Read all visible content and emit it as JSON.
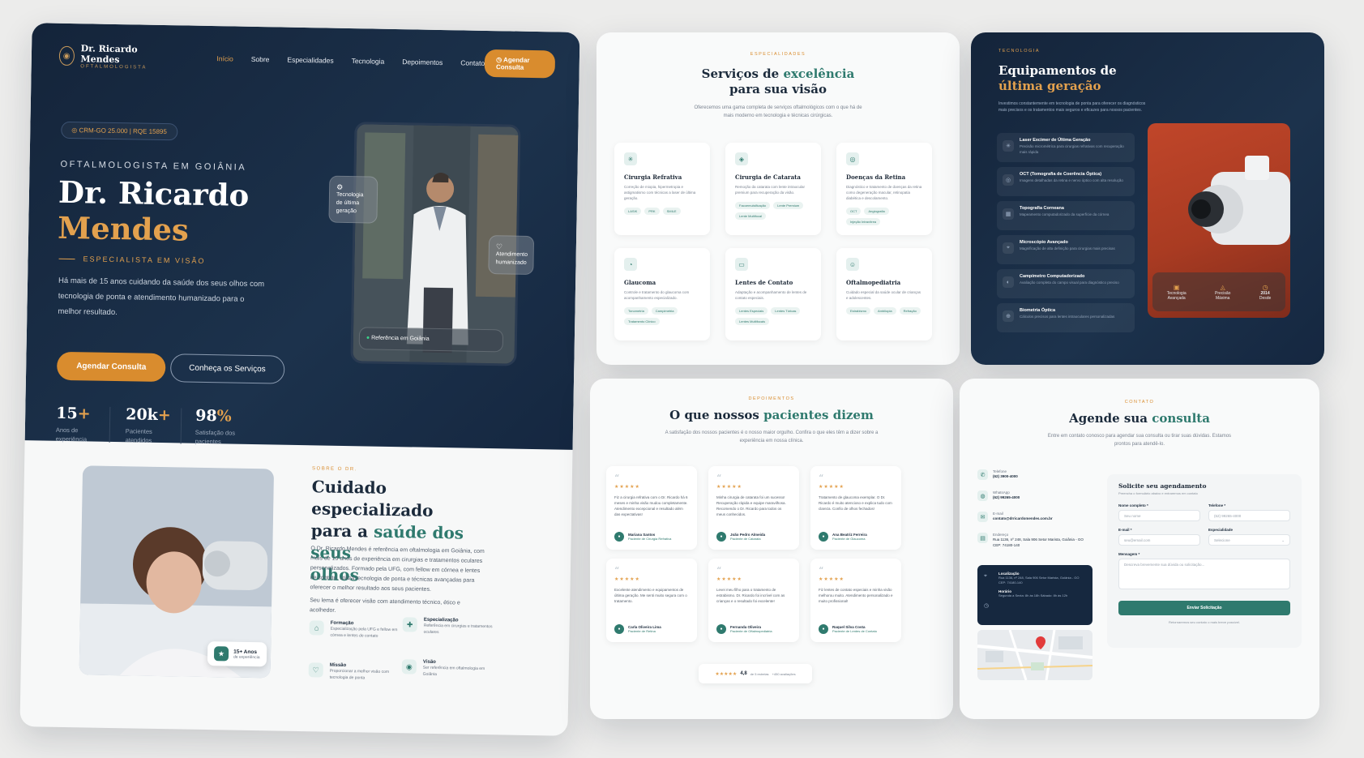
{
  "hero": {
    "logo_name": "Dr. Ricardo Mendes",
    "logo_sub": "OFTALMOLOGISTA",
    "nav": [
      "Início",
      "Sobre",
      "Especialidades",
      "Tecnologia",
      "Depoimentos",
      "Contato"
    ],
    "nav_button": "Agendar Consulta",
    "crm": "CRM-GO 25.000 | RQE 15895",
    "kicker": "OFTALMOLOGISTA EM GOIÂNIA",
    "name_line1": "Dr. Ricardo",
    "name_line2": "Mendes",
    "specialty": "ESPECIALISTA EM VISÃO",
    "description": "Há mais de 15 anos cuidando da saúde dos seus olhos com tecnologia de ponta e atendimento humanizado para o melhor resultado.",
    "cta_primary": "Agendar Consulta",
    "cta_secondary": "Conheça os Serviços",
    "stats": [
      {
        "value": "15",
        "suffix": "+",
        "label": "Anos de experiência"
      },
      {
        "value": "20k",
        "suffix": "+",
        "label": "Pacientes atendidos"
      },
      {
        "value": "98",
        "suffix": "%",
        "label": "Satisfação dos pacientes"
      }
    ],
    "badge_tech": "Tecnologia de última geração",
    "badge_care": "Atendimento humanizado",
    "badge_ref": "Referência em Goiânia"
  },
  "about": {
    "kicker": "SOBRE O DR.",
    "title_a": "Cuidado especializado",
    "title_b": "para a ",
    "title_c": "saúde dos seus",
    "title_d": "olhos",
    "p1": "O Dr. Ricardo Mendes é referência em oftalmologia em Goiânia, com mais de 15 anos de experiência em cirurgias e tratamentos oculares personalizados. Formado pela UFG, com fellow em córnea e lentes de contato, utiliza tecnologia de ponta e técnicas avançadas para oferecer o melhor resultado aos seus pacientes.",
    "p2": "Seu lema é oferecer visão com atendimento técnico, ético e acolhedor.",
    "badge_value": "15+ Anos",
    "badge_label": "de experiência",
    "features": [
      {
        "title": "Formação",
        "desc": "Especialização pela UFG e fellow em córnea e lentes de contato"
      },
      {
        "title": "Especialização",
        "desc": "Referência em cirurgias e tratamentos oculares"
      },
      {
        "title": "Missão",
        "desc": "Proporcionar a melhor visão com tecnologia de ponta"
      },
      {
        "title": "Visão",
        "desc": "Ser referência em oftalmologia em Goiânia"
      }
    ]
  },
  "services": {
    "kicker": "ESPECIALIDADES",
    "title_a": "Serviços de ",
    "title_b": "excelência",
    "title_c": " para sua visão",
    "subtitle": "Oferecemos uma gama completa de serviços oftalmológicos com o que há de mais moderno em tecnologia e técnicas cirúrgicas.",
    "items": [
      {
        "title": "Cirurgia Refrativa",
        "desc": "Correção de miopia, hipermetropia e astigmatismo com técnicas a laser de última geração.",
        "tags": [
          "LASIK",
          "PRK",
          "SMILE"
        ]
      },
      {
        "title": "Cirurgia de Catarata",
        "desc": "Remoção da catarata com lente intraocular premium para recuperação da visão.",
        "tags": [
          "Facoemulsificação",
          "Lente Premium",
          "Lente Multifocal"
        ]
      },
      {
        "title": "Doenças da Retina",
        "desc": "Diagnóstico e tratamento de doenças da retina como degeneração macular, retinopatia diabética e descolamento.",
        "tags": [
          "OCT",
          "Angiografia",
          "Injeção Intravítrea"
        ]
      },
      {
        "title": "Glaucoma",
        "desc": "Controle e tratamento do glaucoma com acompanhamento especializado.",
        "tags": [
          "Tonometria",
          "Campimetria",
          "Tratamento Clínico"
        ]
      },
      {
        "title": "Lentes de Contato",
        "desc": "Adaptação e acompanhamento de lentes de contato especiais.",
        "tags": [
          "Lentes Especiais",
          "Lentes Tóricas",
          "Lentes Multifocais"
        ]
      },
      {
        "title": "Oftalmopediatria",
        "desc": "Cuidado especial da saúde ocular de crianças e adolescentes.",
        "tags": [
          "Estrabismo",
          "Ambliopia",
          "Refração"
        ]
      }
    ]
  },
  "technology": {
    "kicker": "TECNOLOGIA",
    "title_a": "Equipamentos de ",
    "title_b": "última geração",
    "subtitle": "Investimos constantemente em tecnologia de ponta para oferecer os diagnósticos mais precisos e os tratamentos mais seguros e eficazes para nossos pacientes.",
    "items": [
      {
        "title": "Laser Excimer de Última Geração",
        "desc": "Precisão micrométrica para cirurgias refrativas com recuperação mais rápida"
      },
      {
        "title": "OCT (Tomografia de Coerência Óptica)",
        "desc": "Imagens detalhadas da retina e nervo óptico com alta resolução"
      },
      {
        "title": "Topografia Corneana",
        "desc": "Mapeamento computadorizado da superfície da córnea"
      },
      {
        "title": "Microscópio Avançado",
        "desc": "Magnificação de alta definição para cirurgias mais precisas"
      },
      {
        "title": "Campímetro Computadorizado",
        "desc": "Avaliação completa do campo visual para diagnóstico preciso"
      },
      {
        "title": "Biometria Óptica",
        "desc": "Cálculos precisos para lentes intraoculares personalizadas"
      }
    ],
    "badges": [
      {
        "value": "Tecnologia",
        "label": "Avançada"
      },
      {
        "value": "Precisão",
        "label": "Máxima"
      },
      {
        "value": "2014",
        "label": "Desde"
      }
    ]
  },
  "testimonials": {
    "kicker": "DEPOIMENTOS",
    "title_a": "O que nossos ",
    "title_b": "pacientes dizem",
    "subtitle": "A satisfação dos nossos pacientes é o nosso maior orgulho. Confira o que eles têm a dizer sobre a experiência em nossa clínica.",
    "items": [
      {
        "stars": "★★★★★",
        "text": "Fiz a cirurgia refrativa com o Dr. Ricardo há 6 meses e minha visão mudou completamente. Atendimento excepcional e resultado além das expectativas!",
        "name": "Mariana Santos",
        "role": "Paciente de Cirurgia Refrativa"
      },
      {
        "stars": "★★★★★",
        "text": "Minha cirurgia de catarata foi um sucesso! Recuperação rápida e equipe maravilhosa. Recomendo o Dr. Ricardo para todos os meus conhecidos.",
        "name": "João Pedro Almeida",
        "role": "Paciente de Catarata"
      },
      {
        "stars": "★★★★★",
        "text": "Tratamento de glaucoma exemplar. O Dr. Ricardo é muito atencioso e explica tudo com clareza. Confio de olhos fechados!",
        "name": "Ana Beatriz Ferreira",
        "role": "Paciente de Glaucoma"
      },
      {
        "stars": "★★★★★",
        "text": "Excelente atendimento e equipamentos de última geração. Me senti muito segura com o tratamento.",
        "name": "Carla Oliveira Lima",
        "role": "Paciente de Retina"
      },
      {
        "stars": "★★★★★",
        "text": "Levei meu filho para o tratamento de estrabismo. Dr. Ricardo foi incrível com as crianças e o resultado foi excelente!",
        "name": "Fernanda Oliveira",
        "role": "Paciente de Oftalmopediatria"
      },
      {
        "stars": "★★★★★",
        "text": "Fiz lentes de contato especiais e minha visão melhorou muito. Atendimento personalizado e muito profissional!",
        "name": "Raquel Silva Costa",
        "role": "Paciente de Lentes de Contato"
      }
    ],
    "summary_stars": "★★★★★",
    "summary_score": "4,8",
    "summary_of": "de 5 estrelas",
    "summary_count": "+450 avaliações"
  },
  "contact": {
    "kicker": "CONTATO",
    "title_a": "Agende sua ",
    "title_b": "consulta",
    "subtitle": "Entre em contato conosco para agendar sua consulta ou tirar suas dúvidas. Estamos prontos para atendê-lo.",
    "rows": [
      {
        "label": "Telefone",
        "value": "(62) 3900-4000"
      },
      {
        "label": "WhatsApp",
        "value": "(62) 99265-4000"
      },
      {
        "label": "E-mail",
        "value": "contato@drricardomendes.com.br"
      },
      {
        "label": "Endereço",
        "value": "Rua 1136, nº 248, Sala 906 Setor Marista, Goiânia - GO CEP: 74180-140"
      }
    ],
    "location_label": "Localização",
    "location_value": "Rua 1136, nº 248, Sala 906 Setor Marista, Goiânia - GO CEP: 74180-140",
    "hours_label": "Horário",
    "hours_value": "Segunda a Sexta: 8h às 18h Sábado: 8h às 12h",
    "form_title": "Solicite seu agendamento",
    "form_sub": "Preencha o formulário abaixo e entraremos em contato",
    "name_label": "Nome completo *",
    "name_ph": "Seu nome",
    "phone_label": "Telefone *",
    "phone_ph": "(62) 99265-4000",
    "email_label": "E-mail *",
    "email_ph": "seu@email.com",
    "spec_label": "Especialidade",
    "spec_value": "Selecione",
    "msg_label": "Mensagem *",
    "msg_ph": "Descreva brevemente sua dúvida ou solicitação...",
    "submit": "Enviar Solicitação",
    "note": "Retornaremos seu contato o mais breve possível."
  },
  "colors": {
    "navy": "#14243a",
    "gold": "#e3a14e",
    "accent_orange": "#d98c2e",
    "green": "#2f7a6e"
  }
}
